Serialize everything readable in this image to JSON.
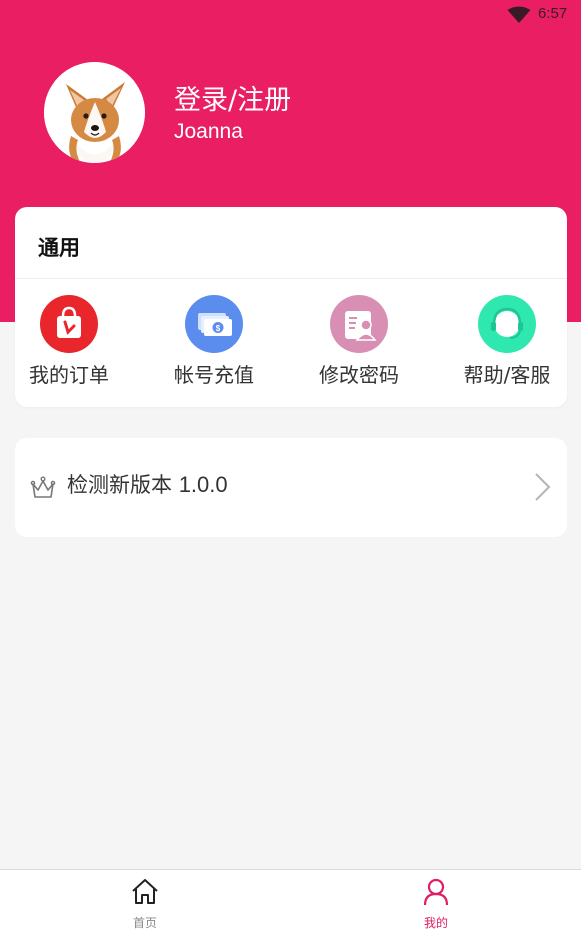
{
  "status_bar": {
    "time": "6:57",
    "wifi_icon": "wifi-icon"
  },
  "profile": {
    "login_text": "登录/注册",
    "username": "Joanna",
    "avatar_icon": "corgi-avatar"
  },
  "colors": {
    "brand": "#ea1f63",
    "order_icon_bg": "#e8262b",
    "recharge_icon_bg": "#5b8def",
    "password_icon_bg": "#d98fb4",
    "help_icon_bg": "#2fe8b0",
    "nav_active": "#e01d66"
  },
  "general": {
    "title": "通用",
    "actions": [
      {
        "label": "我的订单",
        "icon": "shopping-bag-icon"
      },
      {
        "label": "帐号充值",
        "icon": "money-icon"
      },
      {
        "label": "修改密码",
        "icon": "id-card-icon"
      },
      {
        "label": "帮助/客服",
        "icon": "headset-icon"
      }
    ]
  },
  "version": {
    "label": "检测新版本",
    "number": "1.0.0",
    "icon": "crown-icon"
  },
  "nav": {
    "home_label": "首页",
    "mine_label": "我的",
    "active": "mine"
  }
}
